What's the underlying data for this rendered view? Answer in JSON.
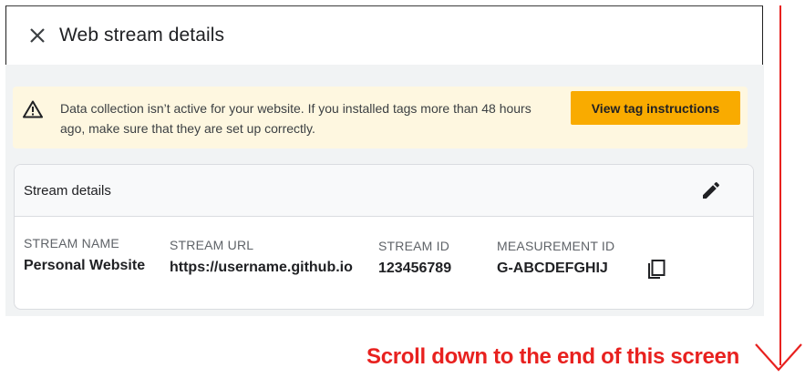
{
  "panel": {
    "title": "Web stream details",
    "close_icon": "close-icon"
  },
  "banner": {
    "icon": "warning-icon",
    "message": "Data collection isn’t active for your website. If you installed tags more than 48 hours ago, make sure  that they are set up correctly.",
    "button_label": "View tag instructions",
    "background": "#fef7e0",
    "button_color": "#f9ab00"
  },
  "stream_details": {
    "title": "Stream details",
    "edit_icon": "pencil-icon",
    "copy_icon": "copy-icon",
    "fields": [
      {
        "label": "STREAM NAME",
        "value": "Personal Website"
      },
      {
        "label": "STREAM URL",
        "value": "https://username.github.io"
      },
      {
        "label": "STREAM ID",
        "value": "123456789"
      },
      {
        "label": "MEASUREMENT ID",
        "value": "G-ABCDEFGHIJ"
      }
    ]
  },
  "annotation": {
    "text": "Scroll down to the end of this screen",
    "color": "#e8211f"
  }
}
